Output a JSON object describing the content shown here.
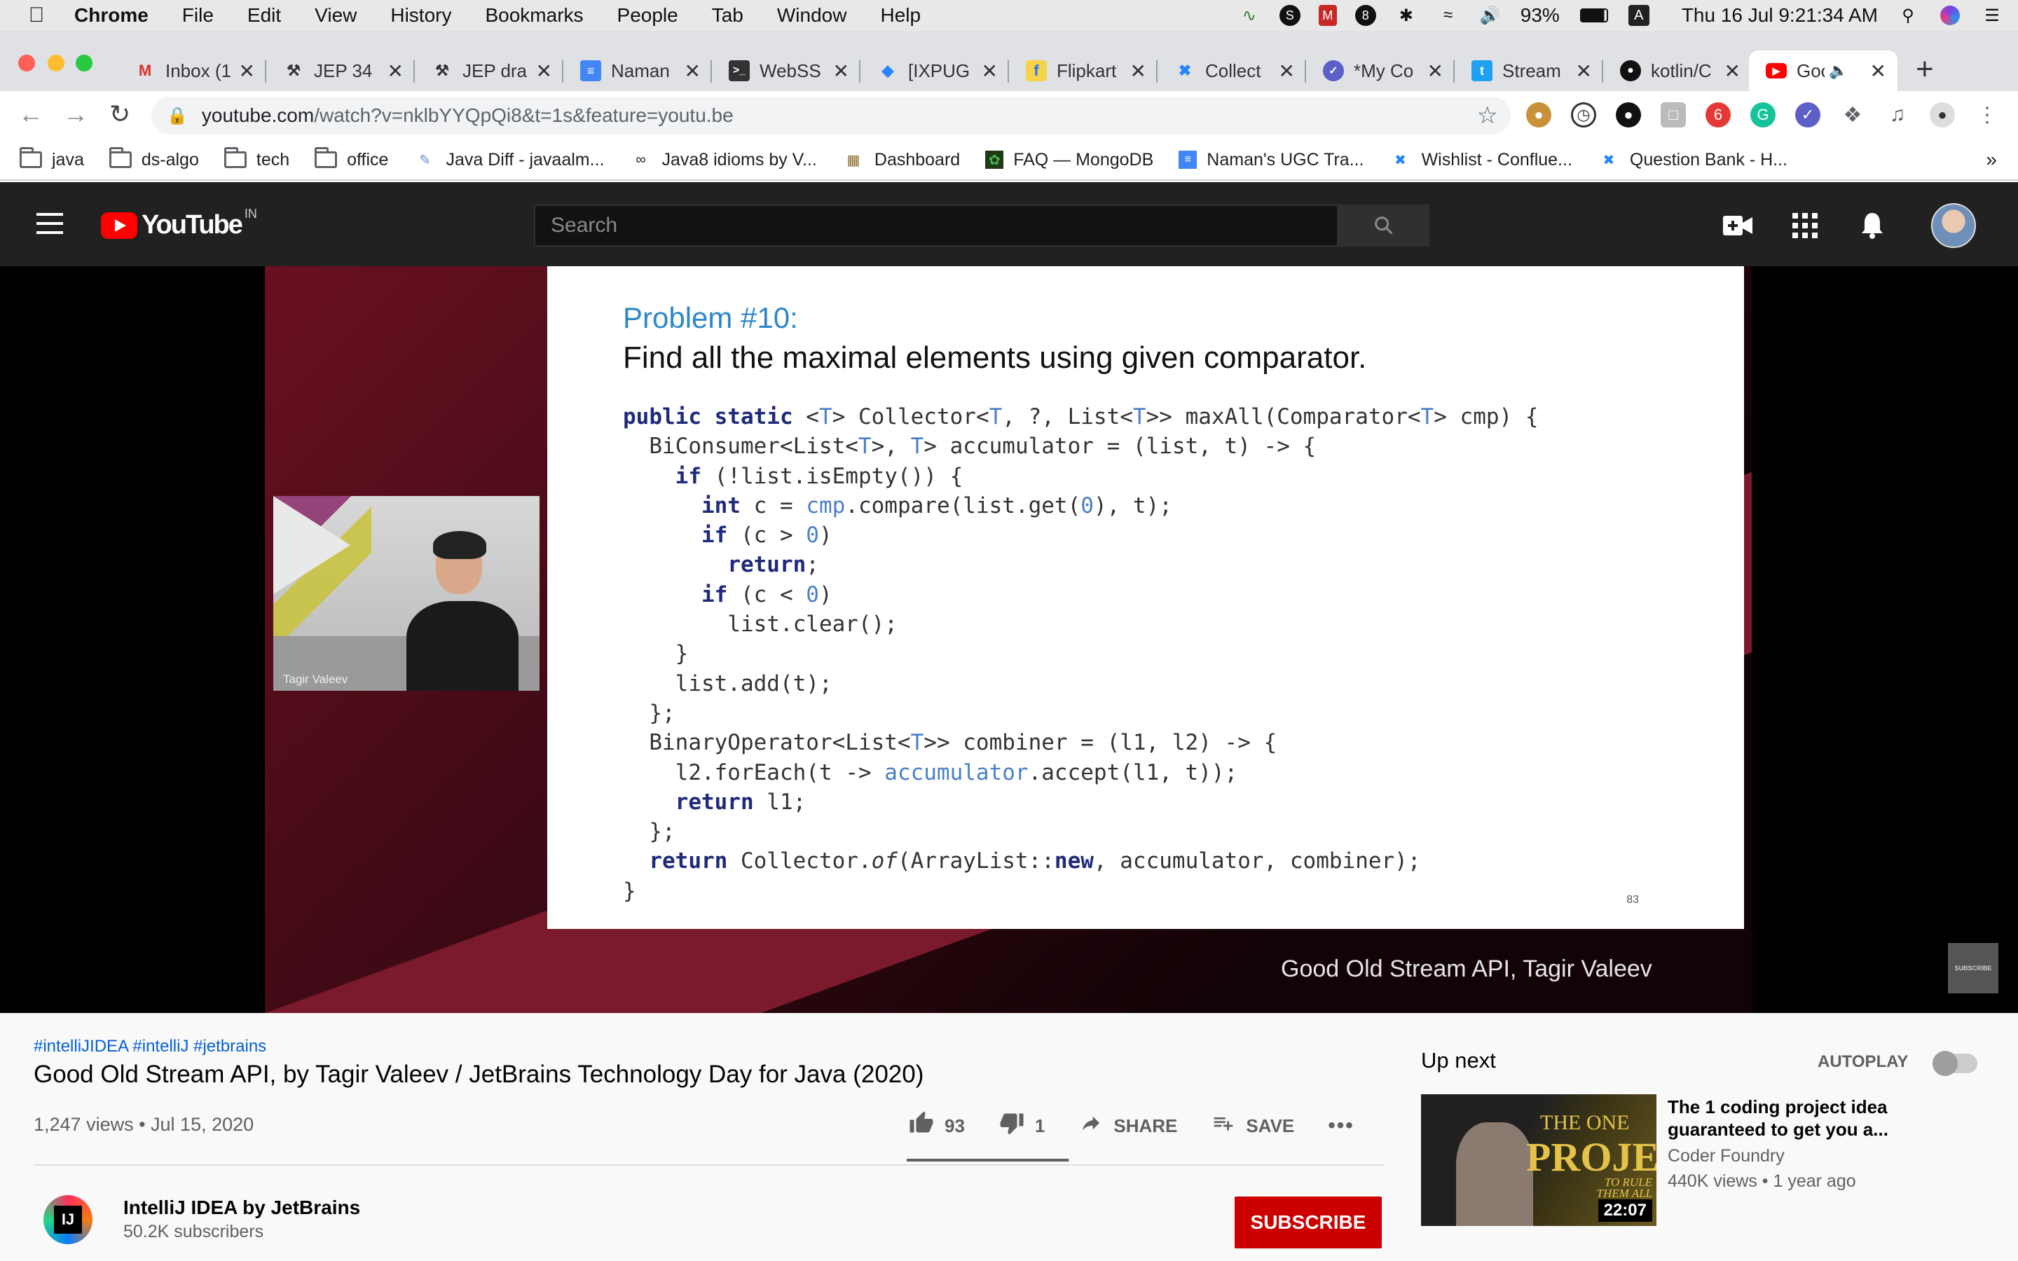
{
  "menubar": {
    "app": "Chrome",
    "items": [
      "File",
      "Edit",
      "View",
      "History",
      "Bookmarks",
      "People",
      "Tab",
      "Window",
      "Help"
    ],
    "battery": "93%",
    "input_source": "A",
    "datetime": "Thu 16 Jul  9:21:34 AM"
  },
  "tabs": [
    {
      "title": "Inbox (1",
      "icon": "gmail-icon"
    },
    {
      "title": "JEP 34",
      "icon": "openjdk-icon"
    },
    {
      "title": "JEP dra",
      "icon": "openjdk-icon"
    },
    {
      "title": "Naman",
      "icon": "google-docs-icon"
    },
    {
      "title": "WebSS",
      "icon": "terminal-icon"
    },
    {
      "title": "[IXPUG",
      "icon": "jira-icon"
    },
    {
      "title": "Flipkart",
      "icon": "flipkart-icon"
    },
    {
      "title": "Collect",
      "icon": "confluence-icon"
    },
    {
      "title": "*My Co",
      "icon": "todo-icon"
    },
    {
      "title": "Stream",
      "icon": "twitter-icon"
    },
    {
      "title": "kotlin/C",
      "icon": "github-icon"
    },
    {
      "title": "Goo",
      "icon": "youtube-icon",
      "active": true
    }
  ],
  "address": {
    "domain": "youtube.com",
    "path": "/watch?v=nklbYYQpQi8&t=1s&feature=youtu.be"
  },
  "bookmarks": [
    {
      "label": "java",
      "icon": "folder-icon"
    },
    {
      "label": "ds-algo",
      "icon": "folder-icon"
    },
    {
      "label": "tech",
      "icon": "folder-icon"
    },
    {
      "label": "office",
      "icon": "folder-icon"
    },
    {
      "label": "Java Diff - javaalm...",
      "icon": "javaalmanac-icon"
    },
    {
      "label": "Java8 idioms by V...",
      "icon": "bike-icon"
    },
    {
      "label": "Dashboard",
      "icon": "dashboard-icon"
    },
    {
      "label": "FAQ — MongoDB",
      "icon": "mongodb-icon"
    },
    {
      "label": "Naman's UGC Tra...",
      "icon": "google-docs-icon"
    },
    {
      "label": "Wishlist - Conflue...",
      "icon": "confluence-icon"
    },
    {
      "label": "Question Bank - H...",
      "icon": "confluence-icon"
    }
  ],
  "youtube": {
    "logo_text": "YouTube",
    "region": "IN",
    "search_placeholder": "Search"
  },
  "slide": {
    "title": "Problem #10:",
    "subtitle": "Find all the maximal elements using given comparator.",
    "page": "83",
    "pip_label": "Tagir Valeev",
    "caption": "Good Old Stream API, Tagir Valeev",
    "watermark": "SUBSCRIBE"
  },
  "video": {
    "hashtags": "#intelliJIDEA #intelliJ #jetbrains",
    "title": "Good Old Stream API, by Tagir Valeev / JetBrains Technology Day for Java (2020)",
    "views": "1,247 views • Jul 15, 2020",
    "likes": "93",
    "dislikes": "1",
    "share": "SHARE",
    "save": "SAVE",
    "like_ratio": 0.99
  },
  "channel": {
    "name": "IntelliJ IDEA by JetBrains",
    "subscribers": "50.2K subscribers",
    "subscribe": "SUBSCRIBE"
  },
  "sidebar": {
    "upnext": "Up next",
    "autoplay": "AUTOPLAY",
    "rec": {
      "title": "The 1 coding project idea guaranteed to get you a...",
      "channel": "Coder Foundry",
      "meta": "440K views • 1 year ago",
      "duration": "22:07",
      "thumb_line1": "THE ONE",
      "thumb_line2": "PROJECT",
      "thumb_line3": "TO RULE THEM ALL"
    }
  }
}
